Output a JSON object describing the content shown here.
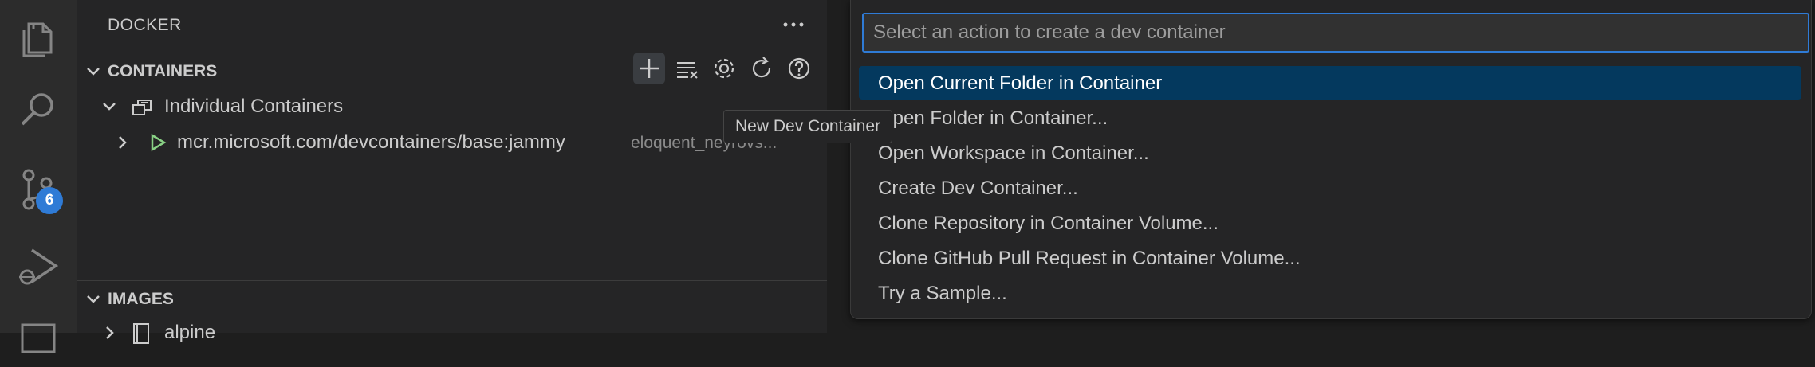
{
  "colors": {
    "accent": "#2f7bd6",
    "selection": "#04395e",
    "run_green": "#89d185",
    "badge": "#2f7bd6"
  },
  "activity_bar": {
    "icons": [
      "explorer-icon",
      "search-icon",
      "source-control-icon",
      "run-debug-icon",
      "panel-icon"
    ],
    "source_control_badge": "6"
  },
  "sidebar": {
    "title": "DOCKER",
    "containers_section": {
      "label": "CONTAINERS",
      "toolbar": [
        "add-icon",
        "prune-icon",
        "gear-icon",
        "refresh-icon",
        "help-icon"
      ],
      "group_label": "Individual Containers",
      "container": {
        "name": "mcr.microsoft.com/devcontainers/base:jammy",
        "description": "eloquent_neyrovs..."
      }
    },
    "images_section": {
      "label": "IMAGES",
      "first_image": "alpine"
    },
    "tooltip": "New Dev Container"
  },
  "quick_pick": {
    "placeholder": "Select an action to create a dev container",
    "items": [
      {
        "label": "Open Current Folder in Container",
        "selected": true
      },
      {
        "label": "Open Folder in Container...",
        "selected": false
      },
      {
        "label": "Open Workspace in Container...",
        "selected": false
      },
      {
        "label": "Create Dev Container...",
        "selected": false
      },
      {
        "label": "Clone Repository in Container Volume...",
        "selected": false
      },
      {
        "label": "Clone GitHub Pull Request in Container Volume...",
        "selected": false
      },
      {
        "label": "Try a Sample...",
        "selected": false
      }
    ]
  }
}
